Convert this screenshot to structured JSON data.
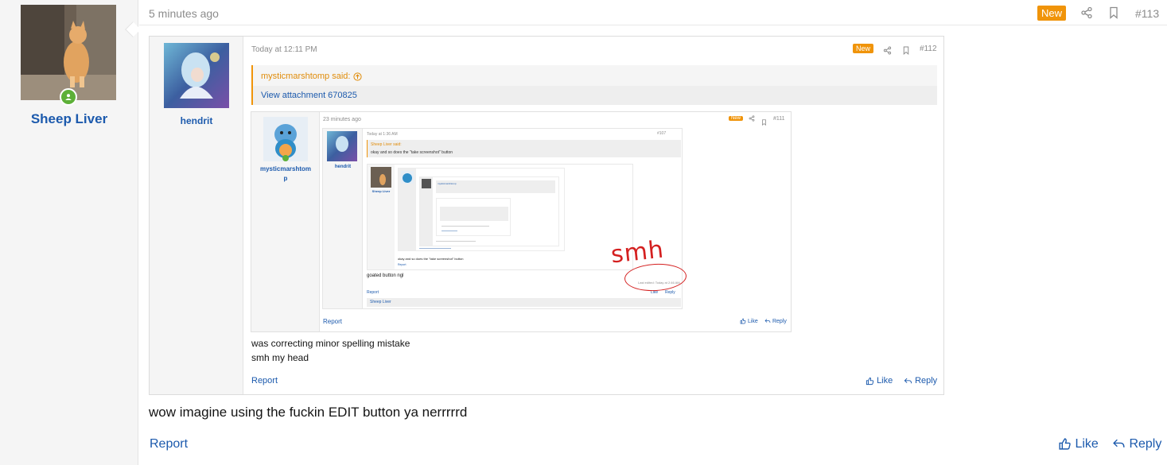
{
  "post": {
    "author": "Sheep Liver",
    "time": "5 minutes ago",
    "badge": "New",
    "number": "#113",
    "body": "wow imagine using the fuckin EDIT button ya nerrrrrd",
    "report_label": "Report",
    "like_label": "Like",
    "reply_label": "Reply"
  },
  "quote1": {
    "author": "hendrit",
    "time": "Today at 12:11 PM",
    "badge": "New",
    "number": "#112",
    "said_header": "mysticmarshtomp said:",
    "attachment_link": "View attachment 670825",
    "body_lines": [
      "was correcting minor spelling mistake",
      "smh my head"
    ],
    "report_label": "Report",
    "like_label": "Like",
    "reply_label": "Reply"
  },
  "quote2": {
    "author_line1": "mysticmarshtom",
    "author_line2": "p",
    "time": "23 minutes ago",
    "badge": "New",
    "number": "#111",
    "report_label": "Report",
    "like_label": "Like",
    "reply_label": "Reply"
  },
  "quote3": {
    "author": "hendrit",
    "time": "Today at 1:36 AM",
    "number": "#107",
    "said_header": "Sheep Liver said:",
    "said_body": "okay and so does the \"take screenshot\" button",
    "body": "goated button ngl",
    "edited": "Last edited: Today at 2:46 AM",
    "report_label": "Report",
    "like_label": "Like",
    "reply_label": "Reply",
    "footer_user": "Sheep Liver"
  },
  "quote4": {
    "author": "Sheep Liver",
    "body": "okay and so does the \"take screenshot\" button",
    "report_label": "Report",
    "inner_name": "mysticmarshtomp"
  },
  "annotation": {
    "text": "smh",
    "color": "#d42020"
  },
  "colors": {
    "link": "#1c5aad",
    "badge": "#f0940a",
    "online": "#5db038"
  }
}
